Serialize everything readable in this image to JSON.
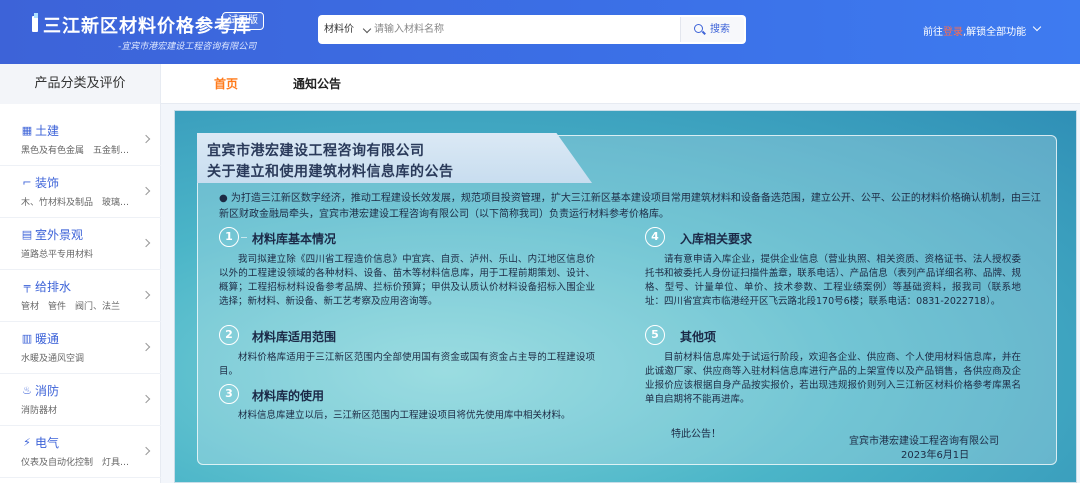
{
  "header": {
    "title": "三江新区材料价格参考库",
    "badge": "试用版",
    "subtitle": "-宜宾市港宏建设工程咨询有限公司",
    "search": {
      "category": "材料价",
      "placeholder": "请输入材料名称",
      "button": "搜索"
    },
    "login_prefix": "前往",
    "login_link": "登录",
    "login_suffix": ",解锁全部功能"
  },
  "nav": {
    "category_title": "产品分类及评价",
    "tabs": [
      {
        "label": "首页"
      },
      {
        "label": "通知公告"
      }
    ]
  },
  "sidebar": {
    "items": [
      {
        "label": "土建",
        "desc": "黑色及有色金属　五金制品　…",
        "icon": "building-icon"
      },
      {
        "label": "装饰",
        "desc": "木、竹材料及制品　玻璃及…",
        "icon": "brush-icon"
      },
      {
        "label": "室外景观",
        "desc": "道路总平专用材料",
        "icon": "landscape-icon"
      },
      {
        "label": "给排水",
        "desc": "管材　管件　阀门、法兰",
        "icon": "pipe-icon"
      },
      {
        "label": "暖通",
        "desc": "水暖及通风空调",
        "icon": "heating-icon"
      },
      {
        "label": "消防",
        "desc": "消防器材",
        "icon": "fire-icon"
      },
      {
        "label": "电气",
        "desc": "仪表及自动化控制　灯具、…",
        "icon": "electric-icon"
      }
    ]
  },
  "notice": {
    "title_line1": "宜宾市港宏建设工程咨询有限公司",
    "title_line2": "关于建立和使用建筑材料信息库的公告",
    "intro": "● 为打造三江新区数字经济，推动工程建设长效发展，规范项目投资管理，扩大三江新区基本建设项目常用建筑材料和设备备选范围，建立公开、公平、公正的材料价格确认机制，由三江新区财政金融局牵头，宜宾市港宏建设工程咨询有限公司（以下简称我司）负责运行材料参考价格库。",
    "sections": [
      {
        "num": "1",
        "title": "材料库基本情况",
        "text": "我司拟建立除《四川省工程造价信息》中宜宾、自贡、泸州、乐山、内江地区信息价以外的工程建设领域的各种材料、设备、苗木等材料信息库，用于工程前期策划、设计、概算；工程招标材料设备参考品牌、拦标价预算；甲供及认质认价材料设备招标入围企业选择；新材料、新设备、新工艺考察及应用咨询等。"
      },
      {
        "num": "2",
        "title": "材料库适用范围",
        "text": "材料价格库适用于三江新区范围内全部使用国有资金或国有资金占主导的工程建设项目。"
      },
      {
        "num": "3",
        "title": "材料库的使用",
        "text": "材料信息库建立以后，三江新区范围内工程建设项目将优先使用库中相关材料。"
      },
      {
        "num": "4",
        "title": "入库相关要求",
        "text": "请有意申请入库企业，提供企业信息（营业执照、相关资质、资格证书、法人授权委托书和被委托人身份证扫描件盖章，联系电话）、产品信息（表列产品详细名称、品牌、规格、型号、计量单位、单价、技术参数、工程业绩案例）等基础资料，报我司（联系地址：四川省宜宾市临港经开区飞云路北段170号6楼；联系电话：0831-2022718）。"
      },
      {
        "num": "5",
        "title": "其他项",
        "text": "目前材料信息库处于试运行阶段，欢迎各企业、供应商、个人使用材料信息库，并在此诚邀厂家、供应商等入驻材料信息库进行产品的上架宣传以及产品销售，各供应商及企业报价应该根据自身产品按实报价，若出现违规报价则列入三江新区材料价格参考库黑名单自启期将不能再进库。"
      }
    ],
    "closing": "特此公告！",
    "signer": "宜宾市港宏建设工程咨询有限公司",
    "date": "2023年6月1日"
  }
}
